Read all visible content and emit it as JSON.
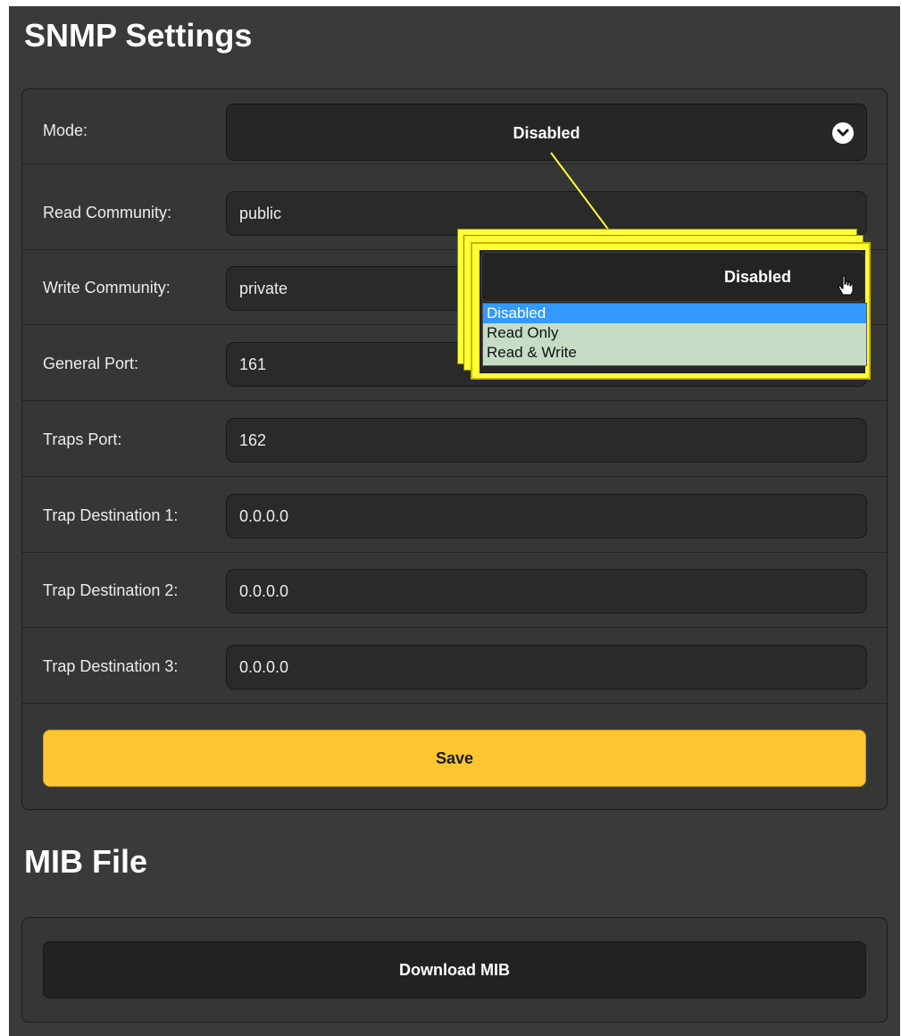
{
  "snmp": {
    "title": "SNMP Settings",
    "mode": {
      "label": "Mode:",
      "value": "Disabled"
    },
    "read_community": {
      "label": "Read Community:",
      "value": "public"
    },
    "write_community": {
      "label": "Write Community:",
      "value": "private"
    },
    "general_port": {
      "label": "General Port:",
      "value": "161"
    },
    "traps_port": {
      "label": "Traps Port:",
      "value": "162"
    },
    "trap_dest_1": {
      "label": "Trap Destination 1:",
      "value": "0.0.0.0"
    },
    "trap_dest_2": {
      "label": "Trap Destination 2:",
      "value": "0.0.0.0"
    },
    "trap_dest_3": {
      "label": "Trap Destination 3:",
      "value": "0.0.0.0"
    },
    "save_label": "Save"
  },
  "mib": {
    "title": "MIB File",
    "download_label": "Download MIB"
  },
  "callout": {
    "select_value": "Disabled",
    "options": [
      "Disabled",
      "Read Only",
      "Read & Write"
    ],
    "selected_option": "Disabled",
    "highlight_color": "#ffff33"
  },
  "colors": {
    "background": "#3a3a3a",
    "panel": "#363636",
    "save_button": "#fdc530",
    "selected_option": "#3399ff"
  },
  "icons": {
    "mode_dropdown": "chevron-down-icon",
    "cursor": "hand-pointer-icon"
  }
}
